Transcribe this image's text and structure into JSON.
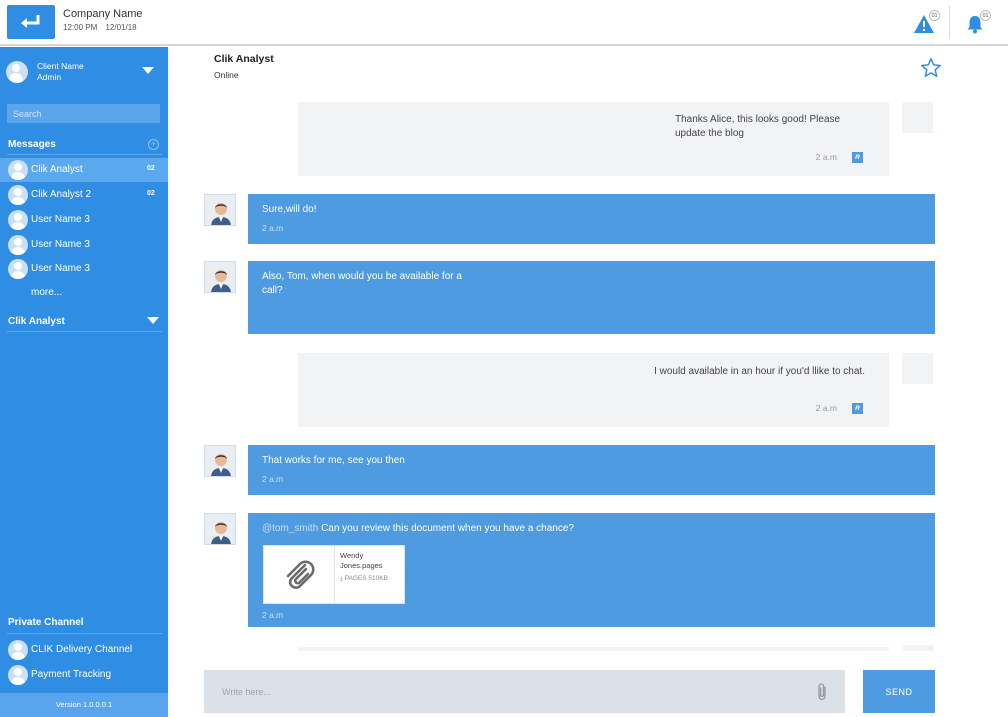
{
  "header": {
    "company_name": "Company Name",
    "time": "12:00 PM",
    "date": "12/01/18",
    "alert_count": "01",
    "notification_count": "01"
  },
  "sidebar": {
    "client_name": "Client Name",
    "client_role": "Admin",
    "search_placeholder": "Search",
    "messages_title": "Messages",
    "items": [
      {
        "label": "Clik Analyst",
        "count": "02"
      },
      {
        "label": "Clik Analyst 2",
        "count": "02"
      },
      {
        "label": "User Name 3"
      },
      {
        "label": "User Name 3"
      },
      {
        "label": "User Name 3"
      }
    ],
    "more_label": "more...",
    "channel_select": "Clik Analyst",
    "private_title": "Private Channel",
    "private_items": [
      {
        "label": "CLIK Delivery Channel"
      },
      {
        "label": "Payment Tracking"
      }
    ],
    "version": "Version 1.0.0.0.1"
  },
  "chat": {
    "contact_name": "Clik Analyst",
    "status": "Online",
    "messages": [
      {
        "type": "sent",
        "text": "Thanks Alice, this looks good! Please update the blog",
        "time": "2 a.m",
        "read": "R"
      },
      {
        "type": "received",
        "text": "Sure,will do!",
        "time": "2 a.m"
      },
      {
        "type": "received",
        "text": "Also, Tom, when would you be available for a call?",
        "time": "2 a.m"
      },
      {
        "type": "sent",
        "text": "I would available in an hour if you'd llike to chat.",
        "time": "2 a.m",
        "read": "R"
      },
      {
        "type": "received",
        "text": "That works for me, see you then",
        "time": "2 a.m"
      },
      {
        "type": "received",
        "mention": "@tom_smith",
        "text": "Can you review this document when you have a chance?",
        "time": "2 a.m",
        "attachment": {
          "name": "Wendy Jones.pages",
          "meta": "PAGES 510KB"
        }
      }
    ]
  },
  "composer": {
    "placeholder": "Write here...",
    "send_label": "SEND"
  },
  "colors": {
    "primary": "#2f8de4",
    "message_blue": "#4f9be2",
    "sent_bubble": "#f2f3f5"
  }
}
